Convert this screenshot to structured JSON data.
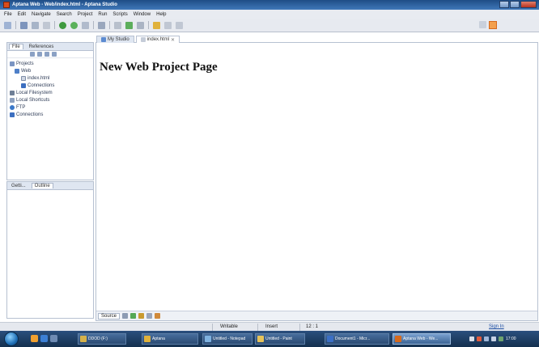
{
  "window": {
    "title": "Aptana Web - Web/index.html - Aptana Studio"
  },
  "menu": [
    "File",
    "Edit",
    "Navigate",
    "Search",
    "Project",
    "Run",
    "Scripts",
    "Window",
    "Help"
  ],
  "left_panel": {
    "tabs": [
      "File",
      "References"
    ],
    "tree": [
      {
        "label": "Projects",
        "icon": "folder-icon"
      },
      {
        "label": "Web",
        "icon": "web-project-icon"
      },
      {
        "label": "index.html",
        "icon": "html-file-icon"
      },
      {
        "label": "Connections",
        "icon": "connections-icon"
      },
      {
        "label": "Local Filesystem",
        "icon": "filesystem-icon"
      },
      {
        "label": "Local Shortcuts",
        "icon": "shortcuts-icon"
      },
      {
        "label": "FTP",
        "icon": "ftp-icon"
      },
      {
        "label": "Connections",
        "icon": "connections-icon"
      }
    ]
  },
  "bottom_left_panel": {
    "tabs": [
      "Getti...",
      "Outline"
    ]
  },
  "editor": {
    "tabs": [
      "My Studio",
      "index.html"
    ],
    "heading": "New Web Project Page",
    "footer_tab": "Source"
  },
  "status": {
    "writable": "Writable",
    "insert": "Insert",
    "position": "12 : 1",
    "sign_in": "Sign In"
  },
  "taskbar": {
    "buttons": [
      "DDOD (F:)",
      "Aptana",
      "Untitled - Notepad",
      "Untitled - Paint",
      "Document1 - Micr...",
      "Aptana Web - We..."
    ],
    "clock": "17:00"
  },
  "colors": {
    "accent": "#d66a1e",
    "title_bar": "#2e5f9c",
    "taskbar": "#1d3a5f"
  }
}
